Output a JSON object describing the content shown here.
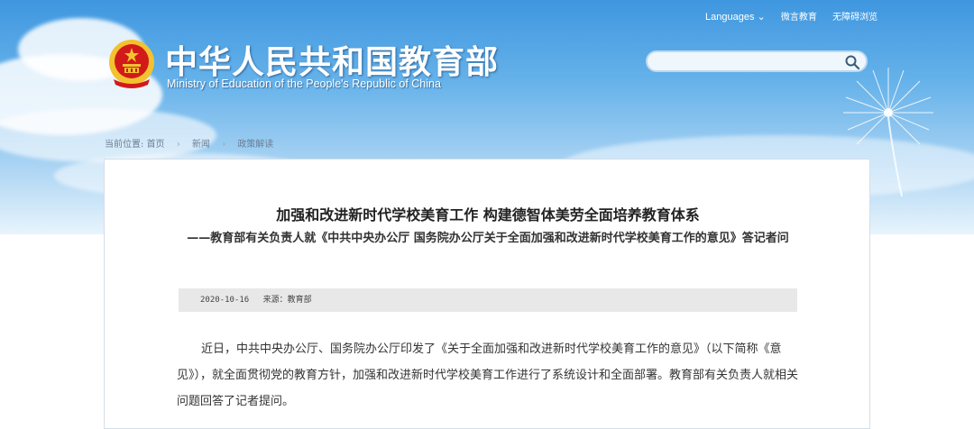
{
  "header": {
    "title_zh": "中华人民共和国教育部",
    "title_en": "Ministry of Education of the People's Republic of China",
    "links": {
      "languages": "Languages ⌄",
      "wechat": "微言教育",
      "accessibility": "无障碍浏览"
    },
    "search": {
      "placeholder": "",
      "icon": "search-icon"
    }
  },
  "breadcrumb": {
    "label": "当前位置:",
    "items": [
      "首页",
      "新闻",
      "政策解读"
    ]
  },
  "article": {
    "title": "加强和改进新时代学校美育工作 构建德智体美劳全面培养教育体系",
    "subtitle": "——教育部有关负责人就《中共中央办公厅 国务院办公厅关于全面加强和改进新时代学校美育工作的意见》答记者问",
    "date": "2020-10-16",
    "source": "来源：教育部",
    "paragraph": "近日，中共中央办公厅、国务院办公厅印发了《关于全面加强和改进新时代学校美育工作的意见》（以下简称《意见》），就全面贯彻党的教育方针，加强和改进新时代学校美育工作进行了系统设计和全面部署。教育部有关负责人就相关问题回答了记者提问。"
  },
  "colors": {
    "sky_top": "#3f97df",
    "sky_bottom": "#e8f4fc",
    "meta_bg": "#e8e8e8",
    "emblem_red": "#d21a1a",
    "emblem_gold": "#f2c230"
  }
}
